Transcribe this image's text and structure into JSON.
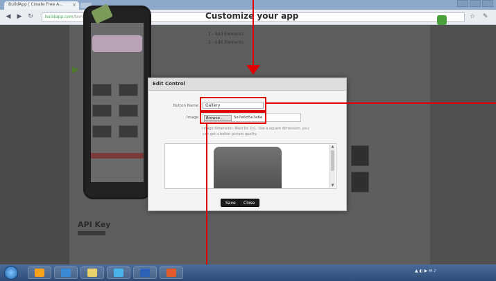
{
  "browser": {
    "tab_title": "BuildApp | Create Free A...",
    "tab_close": "×",
    "url_domain": "buildapp.com",
    "url_rest": "/templates.php?action=..."
  },
  "page": {
    "heading": "Customize your app",
    "step1": "1 - Add Elements",
    "step2": "2 - Edit Elements",
    "api_key": "API Key"
  },
  "modal": {
    "title": "Edit Control",
    "button_name_label": "Button Name",
    "button_name_value": "Gallery",
    "image_label": "Image",
    "browse_label": "Browse...",
    "file_name": "5e7e6d5e7e6e",
    "image_hint": "Image dimension: Must be 1x1. Use a square dimension, you can get a better picture quality.",
    "save_label": "Save",
    "close_label": "Close"
  },
  "colors": {
    "annotation": "#e00000",
    "overlay": "#5a5a5a",
    "taskbar": "#3b5b87"
  },
  "icons": [
    "back-icon",
    "forward-icon",
    "reload-icon",
    "star-icon",
    "wrench-icon",
    "start-orb-icon",
    "chrome-icon",
    "explorer-icon",
    "media-icon"
  ]
}
